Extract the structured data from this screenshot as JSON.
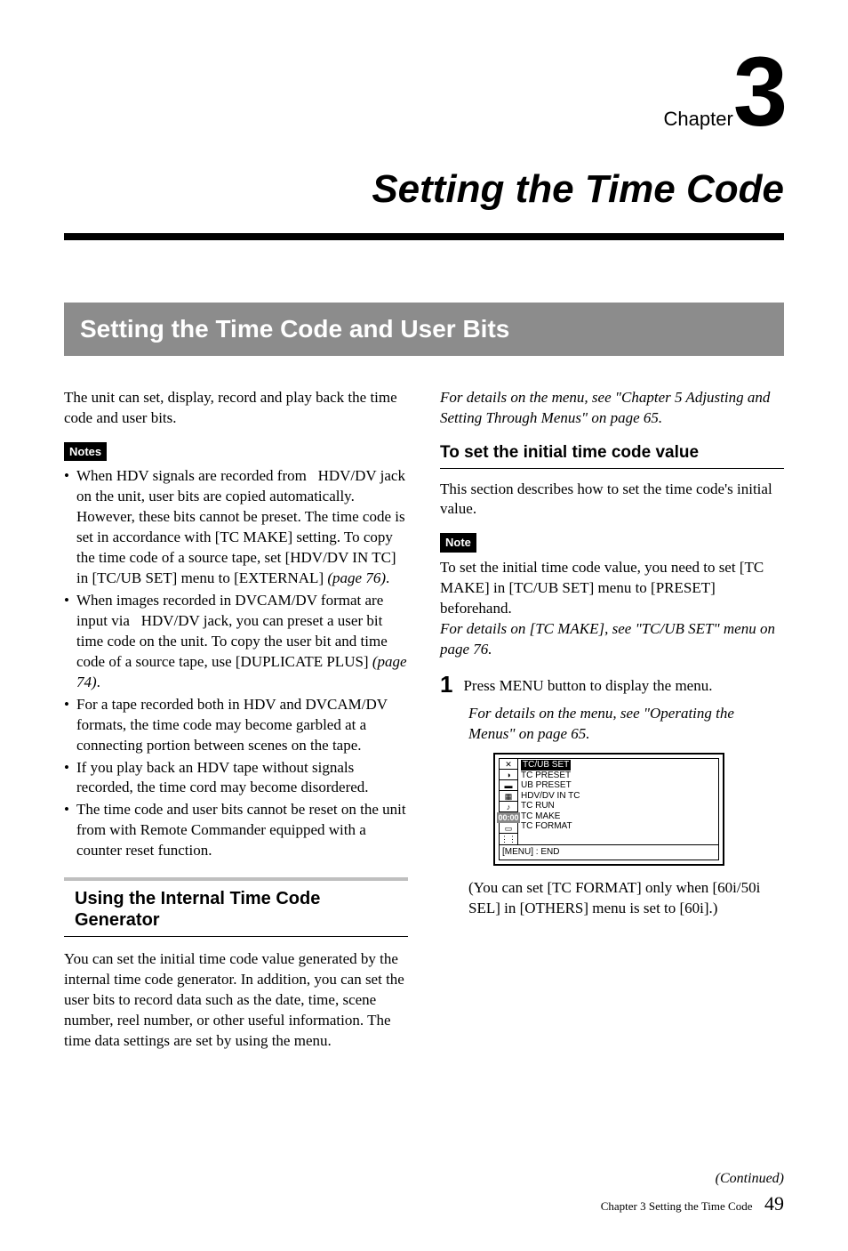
{
  "chapter": {
    "label": "Chapter",
    "number": "3"
  },
  "title": "Setting the Time Code",
  "section_bar": "Setting the Time Code and User Bits",
  "left": {
    "intro": "The unit can set, display, record and play back the time code and user bits.",
    "notes_tag": "Notes",
    "notes": [
      "When HDV signals are recorded from   HDV/DV jack on the unit, user bits are copied automatically. However, these bits cannot be preset. The time code is set in accordance with [TC MAKE] setting. To copy the time code of a source tape, set [HDV/DV IN TC] in [TC/UB SET] menu to [EXTERNAL] ",
      "When images recorded in DVCAM/DV format are input via   HDV/DV jack, you can preset a user bit time code on the unit. To copy the user bit and time code of a source tape, use [DUPLICATE PLUS] ",
      "For a tape recorded both in HDV and DVCAM/DV formats, the time code may become garbled at a connecting portion between scenes on the tape.",
      "If you play back an HDV tape without signals recorded, the time cord may become disordered.",
      "The time code and user bits cannot be reset on the unit from with Remote Commander equipped with a counter reset function."
    ],
    "note_refs": {
      "0": "(page 76)",
      "1": "(page 74)"
    },
    "subhead": "Using the Internal Time Code Generator",
    "subtext": "You can set the initial time code value generated by the internal time code generator. In addition, you can set the user bits to record data such as the date, time, scene number, reel number, or other useful information. The time data settings are set by using the menu."
  },
  "right": {
    "top_ref": "For details on the menu, see \"Chapter 5 Adjusting and Setting Through Menus\" on page 65.",
    "subhead2": "To set the initial time code value",
    "desc": "This section describes how to set the time code's initial value.",
    "note_tag": "Note",
    "note_body": "To set the initial time code value, you need to set [TC MAKE] in [TC/UB SET] menu to [PRESET] beforehand.",
    "note_ref": "For details on [TC MAKE], see \"TC/UB SET\" menu on page 76.",
    "step1_num": "1",
    "step1_text": "Press MENU button to display the menu.",
    "step1_ref": "For details on the menu, see \"Operating the Menus\" on page 65.",
    "menu_items": [
      "TC/UB SET",
      "TC PRESET",
      "UB PRESET",
      "HDV/DV IN TC",
      "TC RUN",
      "TC MAKE",
      "TC FORMAT"
    ],
    "menu_footer": "[MENU] : END",
    "paren_note": "(You can set [TC FORMAT] only when [60i/50i SEL] in [OTHERS] menu is set to [60i].)"
  },
  "footer": {
    "continued": "(Continued)",
    "meta": "Chapter 3   Setting the Time Code",
    "page": "49"
  }
}
